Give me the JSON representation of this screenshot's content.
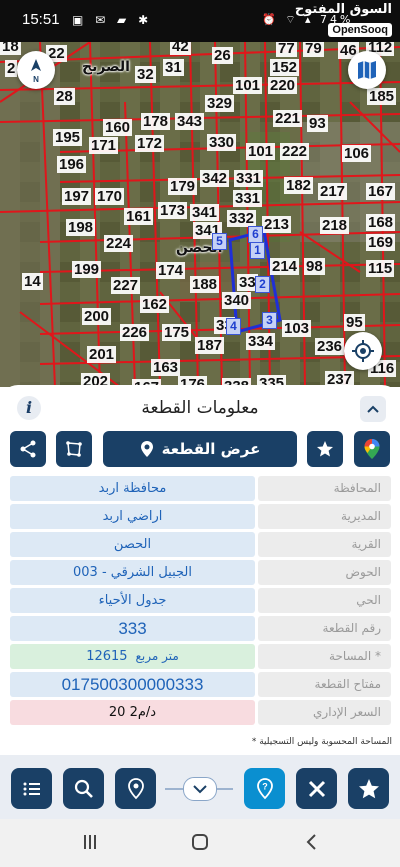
{
  "status_bar": {
    "time": "15:51",
    "left_icons": "▣ ✉ ▰ ✱",
    "right_icons": "⏰ ⌔ ▴ 74%"
  },
  "brand": {
    "arabic": "السوق المفتوح",
    "english": "OpenSooq"
  },
  "map": {
    "place_labels": [
      "الصريح",
      "الحصن"
    ],
    "parcel_numbers": [
      "18",
      "22",
      "42",
      "26",
      "77",
      "79",
      "46",
      "112",
      "2",
      "32",
      "31",
      "152",
      "28",
      "101",
      "220",
      "185",
      "329",
      "195",
      "160",
      "178",
      "343",
      "221",
      "93",
      "171",
      "172",
      "330",
      "101",
      "222",
      "106",
      "196",
      "179",
      "342",
      "331",
      "182",
      "217",
      "167",
      "197",
      "170",
      "331",
      "161",
      "173",
      "341",
      "332",
      "213",
      "218",
      "168",
      "198",
      "341",
      "169",
      "224",
      "14",
      "199",
      "174",
      "214",
      "98",
      "115",
      "227",
      "188",
      "200",
      "162",
      "226",
      "175",
      "103",
      "95",
      "187",
      "334",
      "236",
      "201",
      "163",
      "202",
      "167",
      "176",
      "338",
      "335",
      "237",
      "116"
    ],
    "vertex_labels": [
      "6",
      "5",
      "1",
      "2",
      "3",
      "4"
    ],
    "selected_parcel_labels": [
      "33",
      "340",
      "33"
    ]
  },
  "sheet": {
    "title": "معلومات القطعة",
    "info_label": "i",
    "show_parcel_label": "عرض القطعة",
    "rows": [
      {
        "label": "المحافظة",
        "value": "محافظة اربد"
      },
      {
        "label": "المديرية",
        "value": "اراضي اربد"
      },
      {
        "label": "القرية",
        "value": "الحصن"
      },
      {
        "label": "الحوض",
        "value": "الجبيل الشرقي - 003"
      },
      {
        "label": "الحي",
        "value": "جدول الأحياء"
      },
      {
        "label": "رقم القطعة",
        "value": "333"
      },
      {
        "label": "المساحة *",
        "value": "12615",
        "unit": "متر مربع"
      },
      {
        "label": "مفتاح القطعة",
        "value": "017500300000333"
      },
      {
        "label": "السعر الإداري",
        "value": "20 د/م2"
      }
    ],
    "footnote": "* المساحة المحسوبة وليس التسجيلية"
  },
  "colors": {
    "primary": "#1a4066",
    "accent": "#0a8fd0",
    "parcel_line": "#e0161b",
    "selection": "#1f2fd6"
  },
  "icons": {
    "toolbar": [
      "list-icon",
      "search-icon",
      "location-pin-icon",
      "chevron-down-icon",
      "help-pin-icon",
      "tools-icon",
      "star-icon"
    ]
  }
}
